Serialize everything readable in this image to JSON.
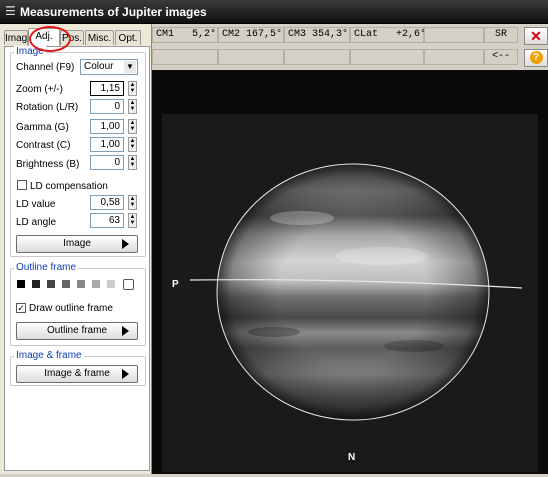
{
  "window": {
    "title": "Measurements of Jupiter images"
  },
  "tabs": [
    "Imag.",
    "Adj.",
    "Pos.",
    "Misc.",
    "Opt."
  ],
  "image_group": {
    "title": "Image",
    "channel": {
      "label": "Channel (F9)",
      "value": "Colour"
    },
    "zoom": {
      "label": "Zoom (+/-)",
      "value": "1,15"
    },
    "rotation": {
      "label": "Rotation (L/R)",
      "value": "0"
    },
    "gamma": {
      "label": "Gamma (G)",
      "value": "1,00"
    },
    "contrast": {
      "label": "Contrast (C)",
      "value": "1,00"
    },
    "brightness": {
      "label": "Brightness (B)",
      "value": "0"
    },
    "ld_compensation": {
      "label": "LD compensation",
      "checked": false
    },
    "ld_value": {
      "label": "LD value",
      "value": "0,58"
    },
    "ld_angle": {
      "label": "LD angle",
      "value": "63"
    },
    "button": "Image"
  },
  "outline_group": {
    "title": "Outline frame",
    "draw": {
      "label": "Draw outline frame",
      "checked": true,
      "mark": "✓"
    },
    "button": "Outline frame",
    "swatches": [
      "#000000",
      "#222222",
      "#444444",
      "#666666",
      "#888888",
      "#aaaaaa",
      "#cccccc",
      "#ffffff"
    ]
  },
  "both_group": {
    "title": "Image & frame",
    "button": "Image & frame"
  },
  "status": {
    "cm1": "CM1   5,2°",
    "cm2": "CM2 167,5°",
    "cm3": "CM3 354,3°",
    "clat": "CLat   +2,6°",
    "sr": "SR",
    "back": "<--"
  },
  "image_labels": {
    "p": "P",
    "n": "N"
  },
  "icons": {
    "close": "close-x-icon",
    "help": "help-question-icon",
    "app": "app-window-icon"
  }
}
